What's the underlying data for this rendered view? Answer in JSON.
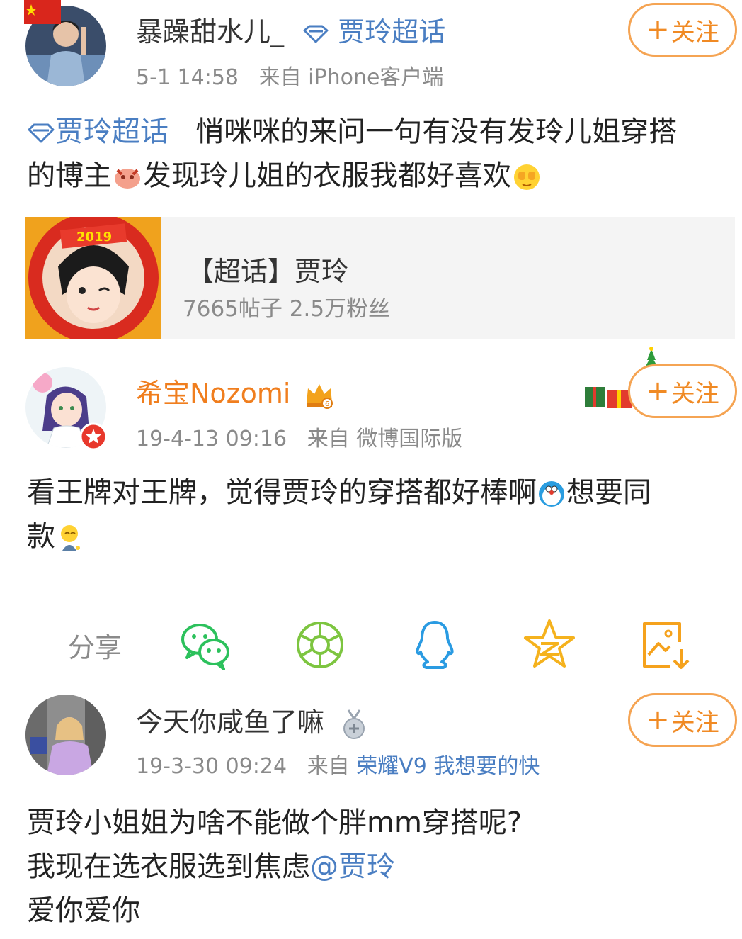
{
  "posts": [
    {
      "username": "暴躁甜水儿_",
      "topic_tag": "贾玲超话",
      "time": "5-1 14:58",
      "source_prefix": "来自",
      "source": "iPhone客户端",
      "follow_label": "关注",
      "text_tag": "贾玲超话",
      "text_line1": "悄咪咪的来问一句有没有发玲儿姐穿搭",
      "text_line2": "的博主",
      "text_line2b": "发现玲儿姐的衣服我都好喜欢"
    },
    {
      "username": "希宝Nozomi",
      "time": "19-4-13 09:16",
      "source_prefix": "来自",
      "source": "微博国际版",
      "follow_label": "关注",
      "text_line1": "看王牌对王牌，觉得贾玲的穿搭都好棒啊",
      "text_line1b": "想要同",
      "text_line2": "款"
    },
    {
      "username": "今天你咸鱼了嘛",
      "time": "19-3-30 09:24",
      "source_prefix": "来自",
      "source": "荣耀V9 我想要的快",
      "follow_label": "关注",
      "text_line1": "贾玲小姐姐为啥不能做个胖mm穿搭呢?",
      "text_line2a": "我现在选衣服选到焦虑",
      "text_line2_mention": "@贾玲",
      "text_line3": "爱你爱你"
    }
  ],
  "topic_card": {
    "title": "【超话】贾玲",
    "stats": "7665帖子 2.5万粉丝"
  },
  "share": {
    "label": "分享",
    "icons": [
      "wechat-icon",
      "moments-icon",
      "qq-icon",
      "qzone-icon",
      "save-image-icon"
    ]
  },
  "colors": {
    "link_blue": "#4a7ec2",
    "follow_orange": "#f08a24",
    "vip_name_orange": "#f07e1e",
    "meta_gray": "#8a8a8a"
  }
}
